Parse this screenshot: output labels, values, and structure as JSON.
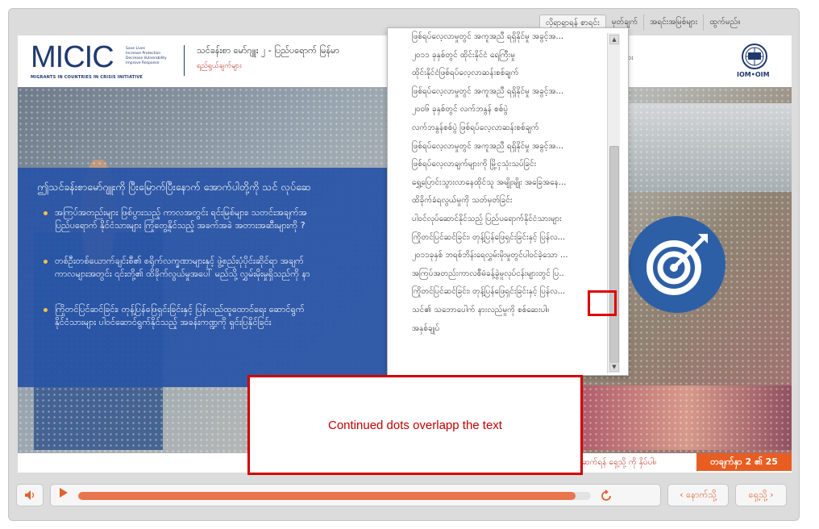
{
  "topnav": {
    "tabs": [
      {
        "label": "လိုရာရှာရန် စာရင်း",
        "active": true
      },
      {
        "label": "မှတ်ချက်",
        "active": false
      },
      {
        "label": "အရင်းအမြစ်များ",
        "active": false
      },
      {
        "label": "ထွက်မည်။",
        "active": false
      }
    ]
  },
  "header": {
    "logo_text": "MICIC",
    "logo_taglines": [
      "Save Lives",
      "Increase Protection",
      "Decrease Vulnerability",
      "Improve Response"
    ],
    "logo_subtitle": "MIGRANTS IN COUNTRIES IN CRISIS INITIATIVE",
    "course_title": "သင်ခန်းစာ မော်ဂျူး ၂ - ပြည်ပရောက် မြန်မာ",
    "course_subtitle": "ရည်ရွယ်ချက်များ",
    "right_fragment": "ား",
    "iom_label": "IOM•OIM"
  },
  "slide": {
    "intro": "ဤသင်ခန်းစာမော်ဂျူးကို ပြီးမြောက်ပြီးနောက် အောက်ပါတို့ကို သင် လုပ်ဆေ",
    "bullets": [
      [
        "အကြပ်အတည်းများ ဖြစ်ပွားသည့် ကာလအတွင်း ရင်းမြစ်များ၊ သတင်းအချက်အ",
        "ပြည်ပရောက် နိုင်ငံသားများ ကြုံတွေ့နိုင်သည့် အခက်အခဲ အတားအဆီးများကို ?"
      ],
      [
        "တစ်ဦးတစ်ယောက်ချင်းစီ၏ စရိုက်လက္ခဏာများနှင့် ဖွဲ့စည်းပုံပိုင်းဆိုင်ရာ အချက်",
        "ကာလများအတွင်း ၎င်းတို့၏ ထိခိုက်လွယ်မှုအပေါ် မည်သို့ လွှမ်းမိုးမှုရှိသည်ကို နာ"
      ],
      [
        "ကြိုတင်ပြင်ဆင်ခြင်း၊ တုန့်ပြန်ဖြေရှင်းခြင်းနှင့် ပြန်လည်ထူထောင်ရေး ဆောင်ရွက်",
        "နိုင်ငံသားများ ပါဝင်ဆောင်ရွက်နိုင်သည့် အခန်းကဏ္ဍကို ရှင်းပြနိုင်ခြင်း"
      ]
    ],
    "footer_hint": "ဆက်ရန် ရှေ့သို့ ကို နှိပ်ပါ။",
    "slide_counter": "တချက်နှာ 2 ၏ 25"
  },
  "menu": {
    "items": [
      "ဖြစ်ရပ်လေ့လာမှုတွင် အကူအညီ ရရှိနိုင်မှု အခွင့်အ...",
      "၂၀၁၁ ခုနှစ်တွင် ထိုင်းနိုင်ငံ ရေကြီးမှု",
      "ထိုင်းနိုင်ငံဖြစ်ရပ်လေ့လာဆန်းစစ်ချက်",
      "ဖြစ်ရပ်လေ့လာမှုတွင် အကူအညီ ရရှိနိုင်မှု အခွင့်အ...",
      "၂၀၀၆ ခုနှစ်တွင် လက်ဘနွန် စစ်ပွဲ",
      "လက်ဘနွန်စစ်ပွဲ ဖြစ်ရပ်လေ့လာဆန်းစစ်ချက်",
      "ဖြစ်ရပ်လေ့လာမှုတွင် အကူအညီ ရရှိနိုင်မှု အခွင့်အ...",
      "ဖြစ်ရပ်လေ့လာချက်များကို မြို့ငှသုံးသပ်ခြင်း",
      "ရွှေ့ပြောင်းသွားလာနေထိုင်သူ အမျိုးမျိုး အခြေအနေ...",
      "ထိခိုက်ခံရလွယ်မှုကို သတ်မှတ်ခြင်း",
      "ပါဝင်လုပ်ဆောင်နိုင်သည့် ပြည်ပရောက်နိုင်ငံသားများ",
      "ကြိုတင်ပြင်ဆင်ခြင်း၊ တုန့်ပြန်ဖြေရှင်းခြင်းနှင့် ပြန်လ...",
      "၂၀၁၁ခုနှစ် ဘရစ်ဘိန်းရေလွှမ်းမိုးမှုတွင်ပါဝင်ခဲ့သော ...",
      "အကြပ်အတည်းကာလစီမံခန့်ခွဲမှုလုပ်ငန်းများတွင် ပြ..",
      "ကြိုတင်ပြင်ဆင်ခြင်း၊ တုန့်ပြန်ဖြေရှင်းခြင်းနှင့် ပြန်လ...",
      "သင်၏ သဘောပေါက် နားလည်မှုကို စစ်ဆေးပါ။",
      "အနှစ်ချုပ်"
    ]
  },
  "annotation": {
    "callout_text": "Continued dots overlapp the text"
  },
  "controls": {
    "prev_label": "‹ နောက်သို့",
    "next_label": "ရှေ့သို့ ›",
    "progress_fraction": 0.97
  }
}
